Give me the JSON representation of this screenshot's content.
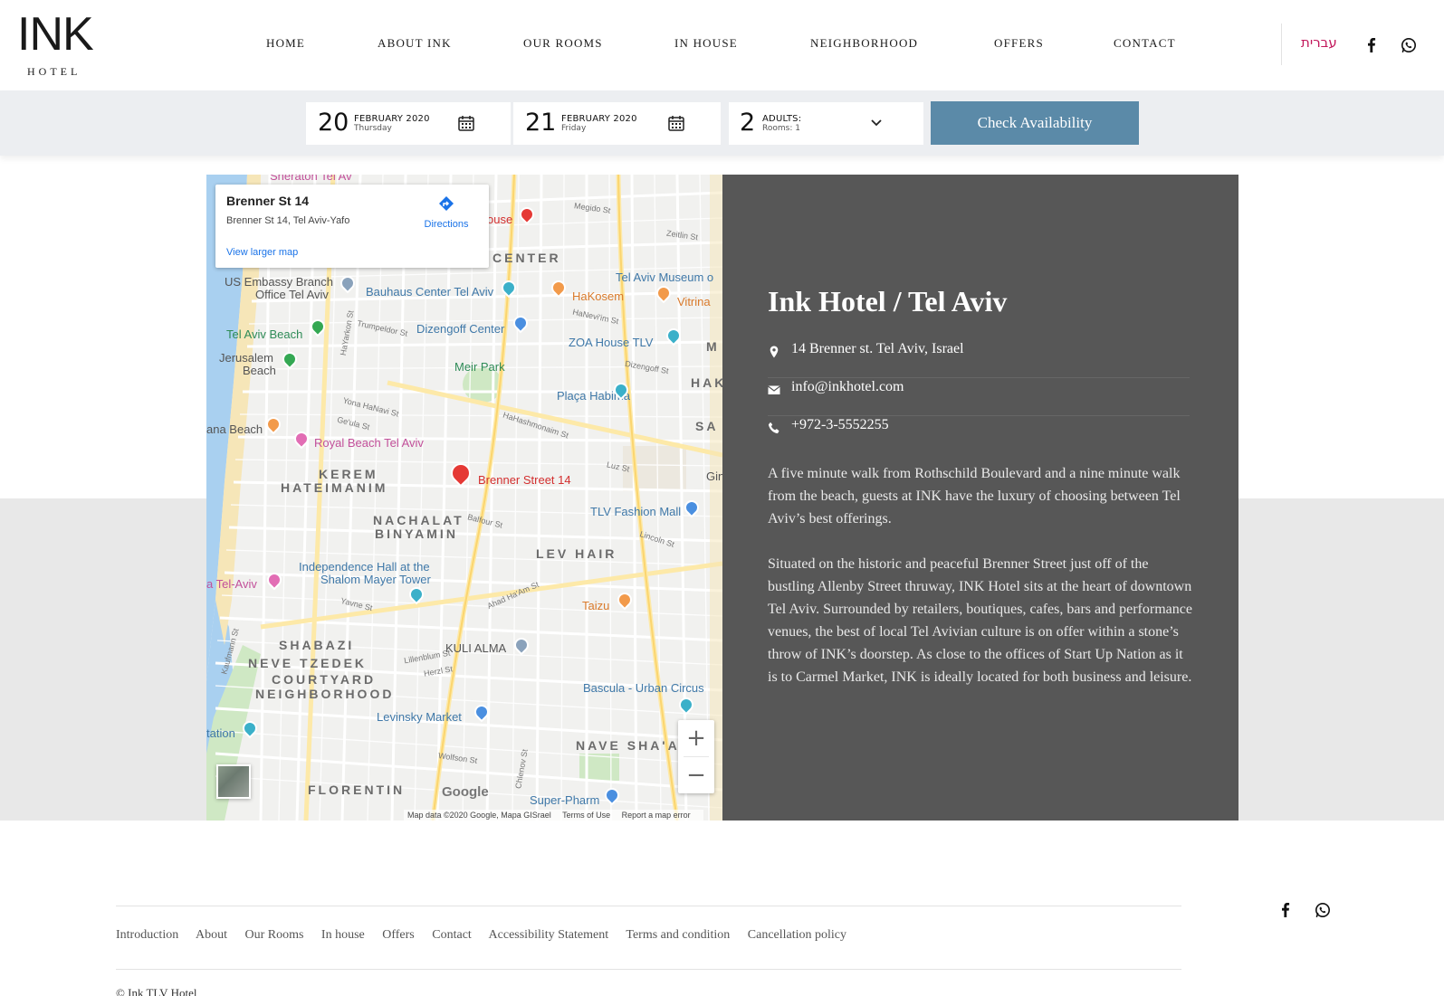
{
  "brand": {
    "logo_word": "INK",
    "logo_sub": "HOTEL"
  },
  "nav": {
    "items": [
      {
        "label": "HOME"
      },
      {
        "label": "ABOUT INK"
      },
      {
        "label": "OUR ROOMS"
      },
      {
        "label": "IN HOUSE"
      },
      {
        "label": "NEIGHBORHOOD"
      },
      {
        "label": "OFFERS"
      },
      {
        "label": "CONTACT"
      }
    ],
    "language": "עברית",
    "icons": [
      "facebook-icon",
      "whatsapp-icon"
    ]
  },
  "booking": {
    "checkin": {
      "day": "20",
      "month": "FEBRUARY 2020",
      "weekday": "Thursday"
    },
    "checkout": {
      "day": "21",
      "month": "FEBRUARY 2020",
      "weekday": "Friday"
    },
    "guests": {
      "count": "2",
      "label": "ADULTS:",
      "rooms": "Rooms: 1"
    },
    "button": "Check Availability",
    "button_color": "#5b8aa8"
  },
  "map": {
    "card": {
      "title": "Brenner St 14",
      "address": "Brenner St 14, Tel Aviv-Yafo",
      "link": "View larger map",
      "directions": "Directions"
    },
    "marker_label": "Brenner Street 14",
    "districts": [
      "CENTER",
      "KEREM",
      "HATEIMANIM",
      "NACHALAT",
      "BINYAMIN",
      "LEV HAIR",
      "SHABAZI",
      "NEVE TZEDEK",
      "COURTYARD",
      "NEIGHBORHOOD",
      "NAVE SHA'A",
      "FLORENTIN",
      "HAK",
      "SA",
      "M"
    ],
    "pois": {
      "embassy": "US Embassy Branch",
      "embassy2": "Office Tel Aviv",
      "bauhaus": "Bauhaus Center Tel Aviv",
      "museum": "Tel Aviv Museum o",
      "hakosem": "HaKosem",
      "vitrina": "Vitrina",
      "beach": "Tel Aviv Beach",
      "dizengoff": "Dizengoff Center",
      "zoa": "ZOA House TLV",
      "jerusalem1": "Jerusalem",
      "jerusalem2": "Beach",
      "meir": "Meir Park",
      "placa": "Plaça Habima",
      "banana": "ana Beach",
      "royal": "Royal Beach Tel Aviv",
      "fashion": "TLV Fashion Mall",
      "indep1": "Independence Hall at the",
      "indep2": "Shalom Mayer Tower",
      "telaviv": "a Tel-Aviv",
      "taizu": "Taizu",
      "kuli": "KULI ALMA",
      "bascula": "Bascula - Urban Circus",
      "levinsky": "Levinsky Market",
      "station": "tation",
      "superpharm": "Super-Pharm",
      "sheraton": "Sheraton Tel Av",
      "house": "ouse",
      "gin": "Gin"
    },
    "streets": {
      "megido": "Megido St",
      "zeitlin": "Zeitlin St",
      "hayarkon": "HaYarkon St",
      "trumpeldor": "Trumpeldor St",
      "dizengoff_st": "Dizengoff St",
      "hanevi": "HaNevi'im St",
      "yona": "Yona HaNavi St",
      "geula": "Ge'ula St",
      "kaufmann": "Kaufmann St",
      "lincoln": "Lincoln St",
      "balfour": "Balfour St",
      "ahad": "Ahad Ha'Am St",
      "wolfson": "Wolfson St",
      "chlenov": "Chlenov St",
      "lillenblum": "Lillenblum St",
      "herzl": "Herzl St",
      "luz": "Luz St",
      "yavne": "Yavne St",
      "hashmonaim": "HaHashmonaim St"
    },
    "google": "Google",
    "attribution": "Map data ©2020 Google, Mapa GISrael",
    "terms": "Terms of Use",
    "report": "Report a map error",
    "zoom_in": "+",
    "zoom_out": "−"
  },
  "info": {
    "title": "Ink Hotel / Tel Aviv",
    "address": "14 Brenner st. Tel Aviv, Israel",
    "email": "info@inkhotel.com",
    "phone": "+972-3-5552255",
    "para1": "A five minute walk from Rothschild Boulevard and a nine minute walk from the beach, guests at INK have the luxury of choosing between Tel Aviv’s best offerings.",
    "para2": "Situated on the historic and peaceful Brenner Street just off of the bustling Allenby Street thruway, INK Hotel sits at the heart of downtown Tel Aviv. Surrounded by retailers, boutiques, cafes, bars and performance venues, the best of local Tel Avivian culture is on offer within a stone’s throw of INK’s doorstep. As close to the offices of Start Up Nation as it is to Carmel Market, INK is ideally located for both business and leisure."
  },
  "footer": {
    "links": [
      "Introduction",
      "About",
      "Our Rooms",
      "In house",
      "Offers",
      "Contact",
      "Accessibility Statement",
      "Terms and condition",
      "Cancellation policy"
    ],
    "bottom": "© Ink TLV Hotel"
  }
}
